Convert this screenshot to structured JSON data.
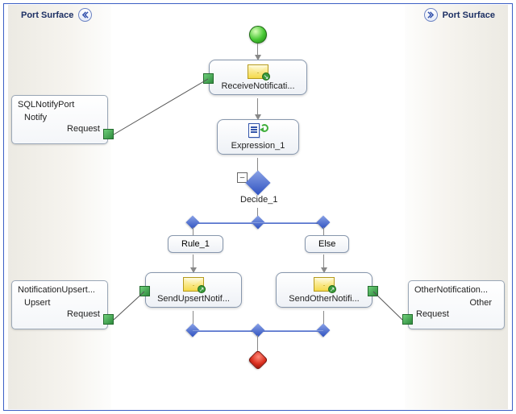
{
  "surfaces": {
    "left": {
      "title": "Port Surface"
    },
    "right": {
      "title": "Port Surface"
    }
  },
  "ports": {
    "left": [
      {
        "name": "SQLNotifyPort",
        "operation": "Notify",
        "message": "Request",
        "direction": "receive"
      },
      {
        "name": "NotificationUpsert...",
        "operation": "Upsert",
        "message": "Request",
        "direction": "send"
      }
    ],
    "right": [
      {
        "name": "OtherNotification...",
        "operation": "Other",
        "message": "Request",
        "direction": "send"
      }
    ]
  },
  "shapes": {
    "start": {
      "type": "start"
    },
    "receive": {
      "type": "receive",
      "label": "ReceiveNotificati...",
      "connectedPort": "SQLNotifyPort"
    },
    "expression": {
      "type": "expression",
      "label": "Expression_1"
    },
    "decide": {
      "type": "decide",
      "label": "Decide_1",
      "collapsed": false,
      "branches": [
        {
          "label": "Rule_1",
          "target": "sendUpsert"
        },
        {
          "label": "Else",
          "target": "sendOther"
        }
      ]
    },
    "sendUpsert": {
      "type": "send",
      "label": "SendUpsertNotif...",
      "connectedPort": "NotificationUpsert..."
    },
    "sendOther": {
      "type": "send",
      "label": "SendOtherNotifi...",
      "connectedPort": "OtherNotification..."
    },
    "end": {
      "type": "end"
    }
  },
  "flow": [
    "start",
    "receive",
    "expression",
    "decide",
    {
      "decide": [
        "sendUpsert",
        "sendOther"
      ]
    },
    "end"
  ]
}
